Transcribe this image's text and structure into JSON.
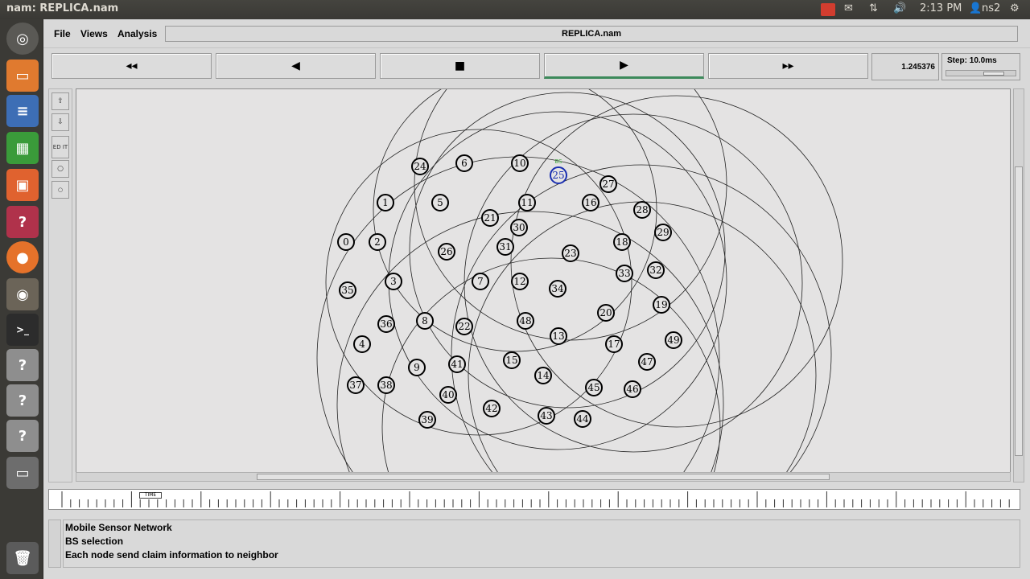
{
  "topbar": {
    "window_title": "nam: REPLICA.nam",
    "time": "2:13 PM",
    "user": "ns2"
  },
  "menu": {
    "file": "File",
    "views": "Views",
    "analysis": "Analysis",
    "filename": "REPLICA.nam"
  },
  "controls": {
    "rewind": "◂◂",
    "back": "◀",
    "stop": "■",
    "play": "▶",
    "forward": "▸▸",
    "time_value": "1.245376",
    "step_label": "Step: 10.0ms"
  },
  "tools": {
    "edit": "ED IT"
  },
  "network": {
    "base_station": "25",
    "bs_tag": "BS",
    "nodes": [
      {
        "id": "0"
      },
      {
        "id": "1"
      },
      {
        "id": "2"
      },
      {
        "id": "3"
      },
      {
        "id": "4"
      },
      {
        "id": "5"
      },
      {
        "id": "6"
      },
      {
        "id": "7"
      },
      {
        "id": "8"
      },
      {
        "id": "9"
      },
      {
        "id": "10"
      },
      {
        "id": "11"
      },
      {
        "id": "12"
      },
      {
        "id": "13"
      },
      {
        "id": "14"
      },
      {
        "id": "15"
      },
      {
        "id": "16"
      },
      {
        "id": "17"
      },
      {
        "id": "18"
      },
      {
        "id": "19"
      },
      {
        "id": "20"
      },
      {
        "id": "21"
      },
      {
        "id": "22"
      },
      {
        "id": "23"
      },
      {
        "id": "24"
      },
      {
        "id": "25"
      },
      {
        "id": "26"
      },
      {
        "id": "27"
      },
      {
        "id": "28"
      },
      {
        "id": "29"
      },
      {
        "id": "30"
      },
      {
        "id": "31"
      },
      {
        "id": "32"
      },
      {
        "id": "33"
      },
      {
        "id": "34"
      },
      {
        "id": "35"
      },
      {
        "id": "36"
      },
      {
        "id": "37"
      },
      {
        "id": "38"
      },
      {
        "id": "39"
      },
      {
        "id": "40"
      },
      {
        "id": "41"
      },
      {
        "id": "42"
      },
      {
        "id": "43"
      },
      {
        "id": "44"
      },
      {
        "id": "45"
      },
      {
        "id": "46"
      },
      {
        "id": "47"
      },
      {
        "id": "48"
      },
      {
        "id": "49"
      }
    ],
    "colors": {
      "node": "#000000",
      "bs": "#1a2fb0",
      "bs_tag": "#3fa63f"
    }
  },
  "timeline": {
    "marker": "TIME"
  },
  "annotations": [
    "Mobile Sensor Network",
    "BS selection",
    "Each node send claim information to neighbor"
  ]
}
